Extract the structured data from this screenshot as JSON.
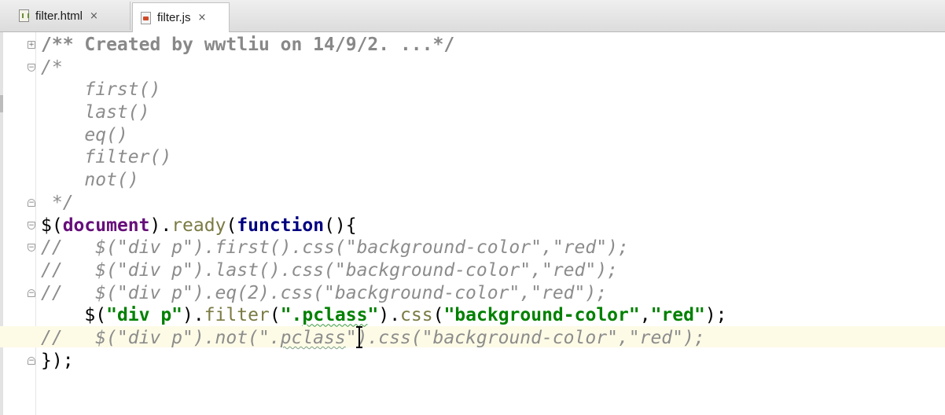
{
  "tabs": [
    {
      "label": "filter.html",
      "icon": "html-file-icon",
      "close": "×",
      "active": false
    },
    {
      "label": "filter.js",
      "icon": "js-file-icon",
      "close": "×",
      "active": true
    }
  ],
  "code": {
    "l1": "/** Created by wwtliu on 14/9/2. ...*/",
    "l2": "/*",
    "l3": "    first()",
    "l4": "    last()",
    "l5": "    eq()",
    "l6": "    filter()",
    "l7": "    not()",
    "l8": " */",
    "l9": {
      "a": "$(",
      "b": "document",
      "c": ").",
      "d": "ready",
      "e": "(",
      "f": "function",
      "g": "(){"
    },
    "l10": "//   $(\"div p\").first().css(\"background-color\",\"red\");",
    "l11": "//   $(\"div p\").last().css(\"background-color\",\"red\");",
    "l12": "//   $(\"div p\").eq(2).css(\"background-color\",\"red\");",
    "l13": {
      "a": "    $(",
      "b": "\"div p\"",
      "c": ").",
      "d": "filter",
      "e": "(",
      "f1": "\".",
      "f2": "pclass",
      "f3": "\"",
      "g": ").",
      "h": "css",
      "i": "(",
      "j": "\"background-color\"",
      "k": ",",
      "l": "\"red\"",
      "m": ");"
    },
    "l14": {
      "a": "//   $(\"div p\").not(\".",
      "b": "pclass",
      "c": "\").css(\"background-color\",\"red\");"
    },
    "l15": "});",
    "fold_plus": "+",
    "fold_minus": "−"
  },
  "colors": {
    "keyword": "#000080",
    "variable": "#660e7a",
    "string": "#008000",
    "comment": "#8c8c8c",
    "caret_row": "#fdfbe6"
  }
}
